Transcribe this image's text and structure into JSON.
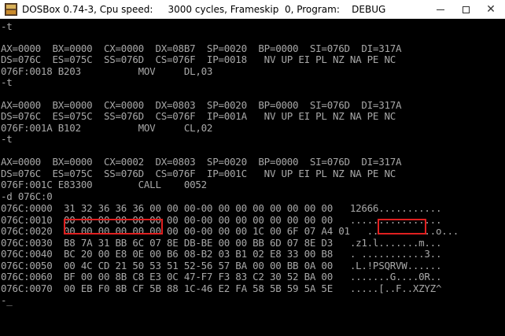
{
  "window": {
    "title": "DOSBox 0.74-3, Cpu speed:     3000 cycles, Frameskip  0, Program:    DEBUG",
    "minimize": "—",
    "maximize": "□",
    "close": "✕"
  },
  "icons": {
    "app": "dosbox-app-icon",
    "minimize": "minimize-icon",
    "maximize": "maximize-icon",
    "close": "close-icon"
  },
  "terminal": {
    "lines": [
      "-t",
      "",
      "AX=0000  BX=0000  CX=0000  DX=08B7  SP=0020  BP=0000  SI=076D  DI=317A",
      "DS=076C  ES=075C  SS=076D  CS=076F  IP=0018   NV UP EI PL NZ NA PE NC",
      "076F:0018 B203          MOV     DL,03",
      "-t",
      "",
      "AX=0000  BX=0000  CX=0000  DX=0803  SP=0020  BP=0000  SI=076D  DI=317A",
      "DS=076C  ES=075C  SS=076D  CS=076F  IP=001A   NV UP EI PL NZ NA PE NC",
      "076F:001A B102          MOV     CL,02",
      "-t",
      "",
      "AX=0000  BX=0000  CX=0002  DX=0803  SP=0020  BP=0000  SI=076D  DI=317A",
      "DS=076C  ES=075C  SS=076D  CS=076F  IP=001C   NV UP EI PL NZ NA PE NC",
      "076F:001C E83300        CALL    0052",
      "-d 076C:0",
      "076C:0000  31 32 36 36 36 00 00 00-00 00 00 00 00 00 00 00   12666...........",
      "076C:0010  00 00 00 00 00 00 00 00-00 00 00 00 00 00 00 00   ................",
      "076C:0020  00 00 00 00 00 00 00 00-00 00 00 1C 00 6F 07 A4 01   ............o...",
      "076C:0030  B8 7A 31 BB 6C 07 8E DB-BE 00 00 BB 6D 07 8E D3   .z1.l.......m...",
      "076C:0040  BC 20 00 E8 0E 00 B6 08-B2 03 B1 02 E8 33 00 B8   . ...........3..",
      "076C:0050  00 4C CD 21 50 53 51 52-56 57 BA 00 00 BB 0A 00   .L.!PSQRVW......",
      "076C:0060  BF 00 00 8B C8 E3 0C 47-F7 F3 83 C2 30 52 BA 00   .......G....0R..",
      "076C:0070  00 EB F0 8B CF 5B 88 1C-46 E2 FA 58 5B 59 5A 5E   .....[..F..XZYZ^",
      "-_"
    ]
  }
}
